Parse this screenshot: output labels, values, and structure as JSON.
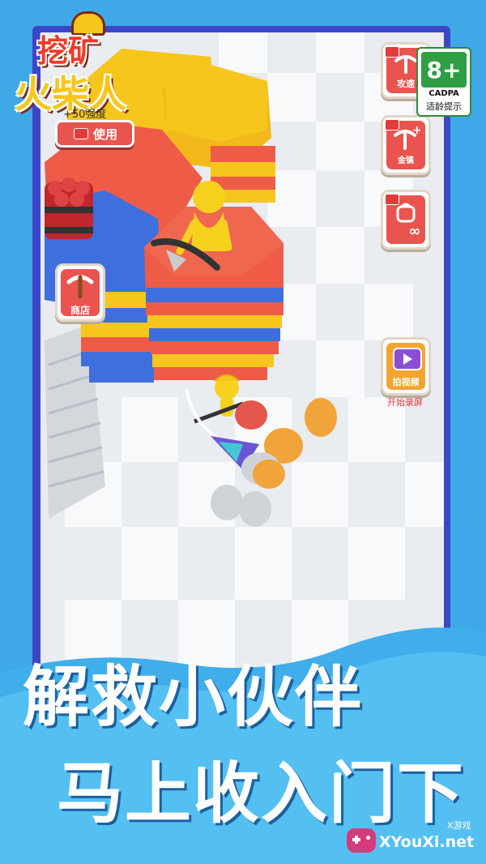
{
  "game": {
    "logo_text": "挖矿火柴人",
    "logo_line1": "挖矿",
    "logo_line2": "火柴人"
  },
  "hud": {
    "top_left_label": "+50强度",
    "use_button": "使用",
    "shop_button": "商店",
    "attack_speed_button": "攻速",
    "gold_button": "金镐",
    "infinite_button": "∞",
    "record_button": "拍视频",
    "record_hint": "开始录屏"
  },
  "age_rating": {
    "value": "8+",
    "org": "CADPA",
    "label": "适龄提示"
  },
  "banner": {
    "line1": "解救小伙伴",
    "line2": "马上收入门下"
  },
  "watermark": {
    "small": "X游戏",
    "site": "XYouXi.net"
  },
  "colors": {
    "sky": "#3fa8e6",
    "frame": "#3c46c8",
    "button_red": "#e9544f",
    "hex_yellow": "#f7c61d",
    "hex_red": "#ee5c48",
    "hex_blue": "#3f6fdc"
  }
}
